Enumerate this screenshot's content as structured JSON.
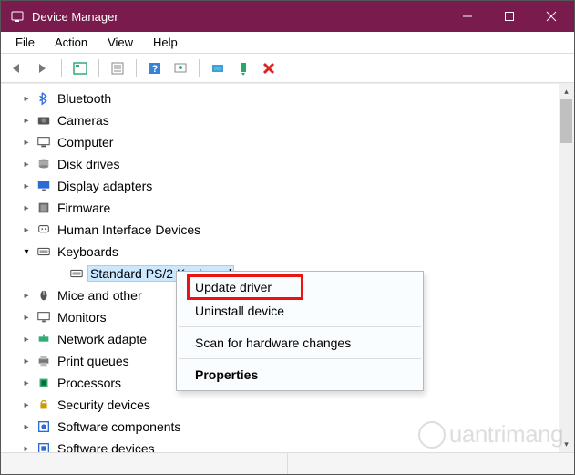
{
  "title": "Device Manager",
  "menubar": [
    "File",
    "Action",
    "View",
    "Help"
  ],
  "tree": [
    {
      "label": "Bluetooth",
      "icon": "bluetooth",
      "expander": ">"
    },
    {
      "label": "Cameras",
      "icon": "camera",
      "expander": ">"
    },
    {
      "label": "Computer",
      "icon": "computer",
      "expander": ">"
    },
    {
      "label": "Disk drives",
      "icon": "disk",
      "expander": ">"
    },
    {
      "label": "Display adapters",
      "icon": "display",
      "expander": ">"
    },
    {
      "label": "Firmware",
      "icon": "firmware",
      "expander": ">"
    },
    {
      "label": "Human Interface Devices",
      "icon": "hid",
      "expander": ">"
    },
    {
      "label": "Keyboards",
      "icon": "keyboard",
      "expander": "v",
      "expanded": true
    },
    {
      "label": "Standard PS/2 Keyboard",
      "icon": "keyboard",
      "child": true,
      "selected": true
    },
    {
      "label": "Mice and other",
      "icon": "mouse",
      "expander": ">",
      "truncated": true
    },
    {
      "label": "Monitors",
      "icon": "monitor",
      "expander": ">"
    },
    {
      "label": "Network adapte",
      "icon": "network",
      "expander": ">",
      "truncated": true
    },
    {
      "label": "Print queues",
      "icon": "printer",
      "expander": ">"
    },
    {
      "label": "Processors",
      "icon": "cpu",
      "expander": ">"
    },
    {
      "label": "Security devices",
      "icon": "security",
      "expander": ">"
    },
    {
      "label": "Software components",
      "icon": "sw-comp",
      "expander": ">"
    },
    {
      "label": "Software devices",
      "icon": "sw-dev",
      "expander": ">"
    }
  ],
  "context_menu": {
    "items": [
      {
        "label": "Update driver",
        "highlighted": true
      },
      {
        "label": "Uninstall device"
      },
      {
        "sep": true
      },
      {
        "label": "Scan for hardware changes"
      },
      {
        "sep": true
      },
      {
        "label": "Properties",
        "bold": true
      }
    ]
  },
  "watermark": "uantrimang"
}
